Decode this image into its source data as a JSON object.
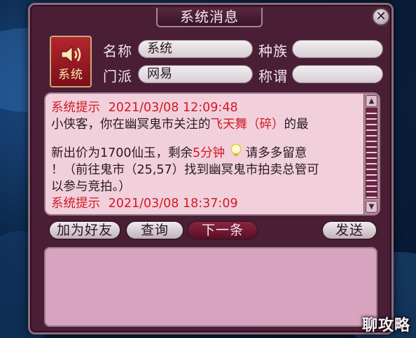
{
  "window": {
    "title": "系统消息",
    "close_symbol": "✕"
  },
  "avatar": {
    "icon": "speaker-icon",
    "label": "系统"
  },
  "fields": {
    "name_label": "名称",
    "name_value": "系统",
    "race_label": "种族",
    "race_value": "",
    "sect_label": "门派",
    "sect_value": "网易",
    "title_label": "称谓",
    "title_value": ""
  },
  "messages": [
    {
      "sender": "系统提示",
      "time": "2021/03/08 12:09:48",
      "line1_pre": "小侠客，你在幽冥鬼市关注的",
      "line1_item": "飞天舞（碎）",
      "line1_post": "的最",
      "line2_pre": "新出价为1700仙玉，剩余",
      "line2_time": "5分钟",
      "line2_icon": "lightbulb-icon",
      "line2_post": "请多多留意",
      "line3": "！（前往鬼市（25,57）找到幽冥鬼市拍卖总管可",
      "line4": "以参与竞拍。）"
    },
    {
      "sender": "系统提示",
      "time": "2021/03/08 18:37:09"
    }
  ],
  "buttons": {
    "add_friend": "加为好友",
    "query": "查询",
    "next": "下一条",
    "send": "发送"
  },
  "watermark": "聊攻略",
  "colors": {
    "frame": "#4a1f36",
    "panel": "#f1d0dc",
    "highlight_red": "#d11a25",
    "input_panel": "#d7a3bf"
  }
}
